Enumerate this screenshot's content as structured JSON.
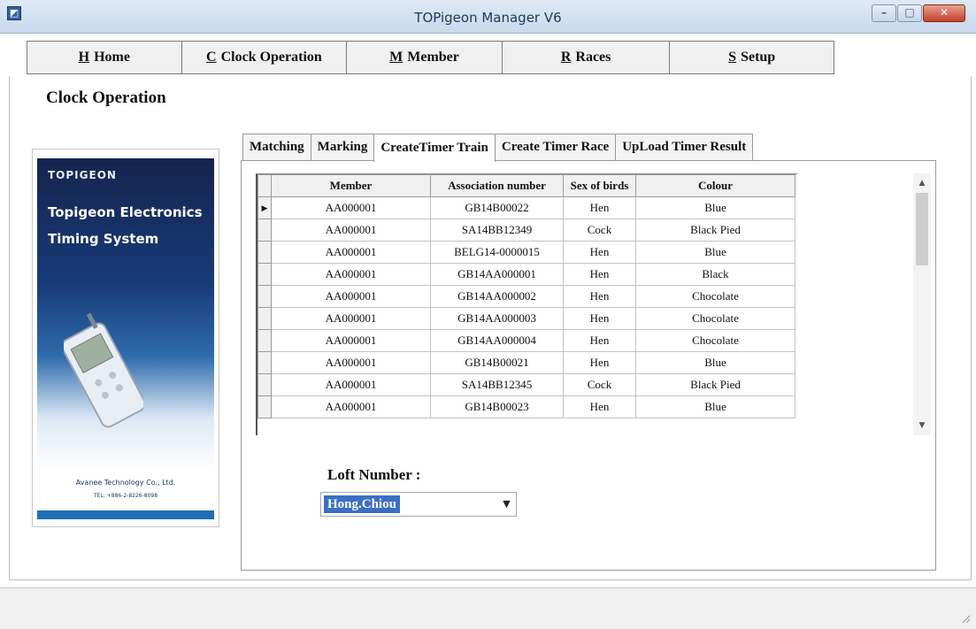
{
  "window": {
    "title": "TOPigeon Manager V6",
    "icon": "app-icon",
    "controls": {
      "minimize": "–",
      "maximize": "□",
      "close": "✕"
    }
  },
  "menu": [
    {
      "key": "H",
      "label": "Home"
    },
    {
      "key": "C",
      "label": "Clock Operation"
    },
    {
      "key": "M",
      "label": "Member"
    },
    {
      "key": "R",
      "label": "Races"
    },
    {
      "key": "S",
      "label": "Setup"
    }
  ],
  "page_title": "Clock Operation",
  "brand": {
    "logo": "TOPIGEON",
    "line1": "Topigeon Electronics",
    "line2": "Timing System",
    "company": "Avanee Technology Co., Ltd.",
    "tel": "TEL: +886-2-8226-8098"
  },
  "tabs": [
    {
      "label": "Matching",
      "active": false
    },
    {
      "label": "Marking",
      "active": false
    },
    {
      "label": "CreateTimer Train",
      "active": true
    },
    {
      "label": "Create Timer Race",
      "active": false
    },
    {
      "label": "UpLoad Timer Result",
      "active": false
    }
  ],
  "grid": {
    "columns": [
      "Member",
      "Association number",
      "Sex of birds",
      "Colour"
    ],
    "current_row_marker": "▶",
    "rows": [
      {
        "member": "AA000001",
        "assoc": "GB14B00022",
        "sex": "Hen",
        "colour": "Blue"
      },
      {
        "member": "AA000001",
        "assoc": "SA14BB12349",
        "sex": "Cock",
        "colour": "Black Pied"
      },
      {
        "member": "AA000001",
        "assoc": "BELG14-0000015",
        "sex": "Hen",
        "colour": "Blue"
      },
      {
        "member": "AA000001",
        "assoc": "GB14AA000001",
        "sex": "Hen",
        "colour": "Black"
      },
      {
        "member": "AA000001",
        "assoc": "GB14AA000002",
        "sex": "Hen",
        "colour": "Chocolate"
      },
      {
        "member": "AA000001",
        "assoc": "GB14AA000003",
        "sex": "Hen",
        "colour": "Chocolate"
      },
      {
        "member": "AA000001",
        "assoc": "GB14AA000004",
        "sex": "Hen",
        "colour": "Chocolate"
      },
      {
        "member": "AA000001",
        "assoc": "GB14B00021",
        "sex": "Hen",
        "colour": "Blue"
      },
      {
        "member": "AA000001",
        "assoc": "SA14BB12345",
        "sex": "Cock",
        "colour": "Black Pied"
      },
      {
        "member": "AA000001",
        "assoc": "GB14B00023",
        "sex": "Hen",
        "colour": "Blue"
      }
    ]
  },
  "scrollbar": {
    "up": "▲",
    "down": "▼"
  },
  "loft": {
    "label": "Loft Number :",
    "value": "Hong.Chiou",
    "dropdown": "▼"
  }
}
